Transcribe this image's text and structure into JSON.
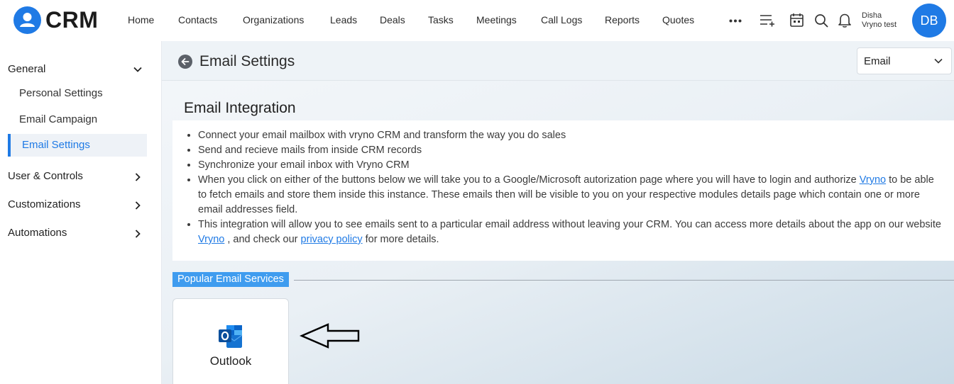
{
  "app": {
    "logo_text": "CRM"
  },
  "nav": {
    "items": [
      {
        "label": "Home"
      },
      {
        "label": "Contacts"
      },
      {
        "label": "Organizations"
      },
      {
        "label": "Leads"
      },
      {
        "label": "Deals"
      },
      {
        "label": "Tasks"
      },
      {
        "label": "Meetings"
      },
      {
        "label": "Call Logs"
      },
      {
        "label": "Reports"
      },
      {
        "label": "Quotes"
      }
    ],
    "icons": [
      "more-icon",
      "add-list-icon",
      "calendar-icon",
      "search-icon",
      "bell-icon"
    ]
  },
  "user": {
    "first_line": "Disha",
    "second_line": "Vryno test",
    "initials": "DB"
  },
  "sidebar": {
    "general": {
      "label": "General",
      "items": [
        {
          "label": "Personal Settings"
        },
        {
          "label": "Email Campaign"
        },
        {
          "label": "Email Settings"
        }
      ]
    },
    "sections": [
      {
        "label": "User & Controls"
      },
      {
        "label": "Customizations"
      },
      {
        "label": "Automations"
      }
    ]
  },
  "page": {
    "title": "Email Settings",
    "select_value": "Email"
  },
  "integration": {
    "title": "Email Integration",
    "bullets": {
      "b1": "Connect your email mailbox with vryno CRM and transform the way you do sales",
      "b2": "Send and recieve mails from inside CRM records",
      "b3": "Synchronize your email inbox with Vryno CRM",
      "b4_before": "When you click on either of the buttons below we will take you to a Google/Microsoft autorization page where you will have to login and authorize ",
      "b4_link": "Vryno",
      "b4_after": " to be able to fetch emails and store them inside this instance. These emails then will be visible to you on your respective modules details page which contain one or more email addresses field.",
      "b5_before": "This integration will allow you to see emails sent to a particular email address without leaving your CRM. You can access more details about the app on our website ",
      "b5_link1": "Vryno",
      "b5_mid": " , and check our ",
      "b5_link2": "privacy policy",
      "b5_after": " for more details."
    }
  },
  "popular": {
    "label": "Popular Email Services",
    "services": [
      {
        "label": "Outlook",
        "icon": "outlook-icon"
      }
    ]
  },
  "colors": {
    "accent": "#1f7ae5",
    "label_bg": "#3f9cef"
  }
}
